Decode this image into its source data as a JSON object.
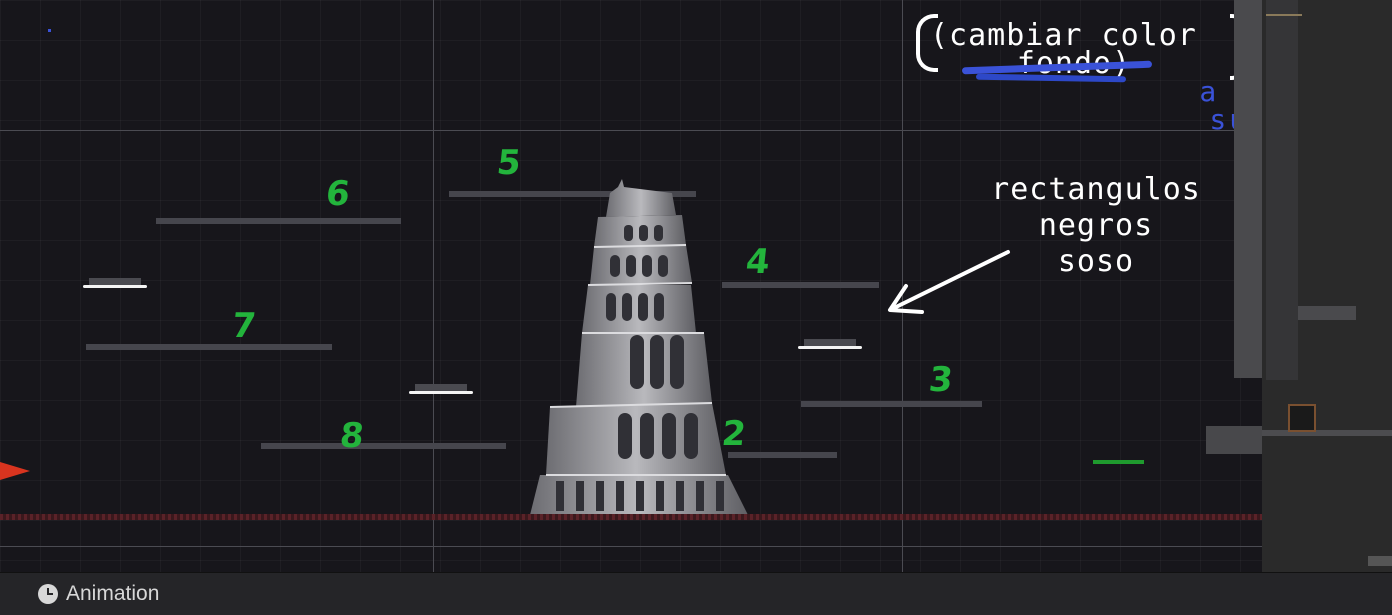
{
  "scene": {
    "platform_numbers": [
      "6",
      "5",
      "4",
      "7",
      "3",
      "8",
      "2"
    ],
    "note_platforms": [
      "rectangulos",
      "negros",
      "soso"
    ],
    "note_background": [
      "(cambiar color",
      "fondo)"
    ],
    "note_blue": [
      "a azul",
      "suave"
    ],
    "colors": {
      "background": "#17161b",
      "platform": "#46464d",
      "number": "#23b43c",
      "annotation_white": "#ffffff",
      "annotation_blue": "#3a52d8",
      "ground": "#5a2228"
    }
  },
  "bottom_bar": {
    "tab_label": "Animation",
    "tab_icon": "clock-icon"
  }
}
